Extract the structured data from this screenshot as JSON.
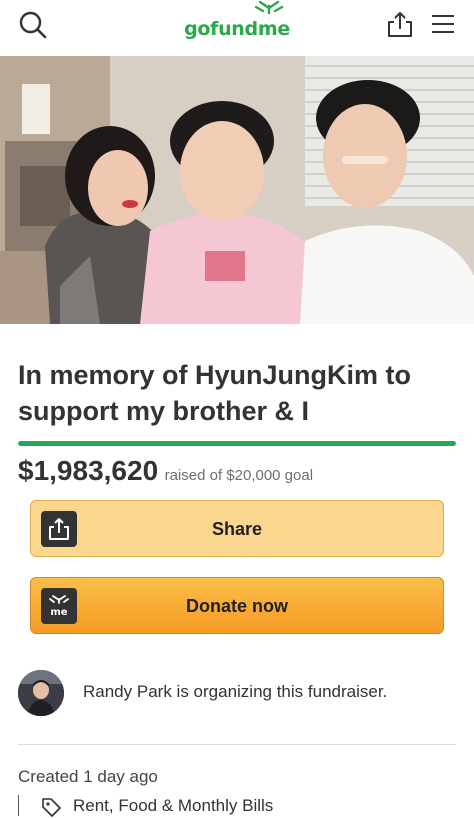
{
  "header": {
    "logo_text": "gofundme",
    "icons": [
      "search-icon",
      "sprout-icon",
      "share-upload-icon",
      "hamburger-menu-icon"
    ]
  },
  "campaign": {
    "title": "In memory of HyunJungKim to support my brother & I",
    "raised_amount": "$1,983,620",
    "goal_text": "raised of $20,000 goal",
    "progress_fraction": 1.0
  },
  "actions": {
    "share_label": "Share",
    "donate_label": "Donate now",
    "donate_icon_text": "me"
  },
  "organizer": {
    "text": "Randy Park is organizing this fundraiser."
  },
  "meta": {
    "created": "Created 1 day ago",
    "category": "Rent, Food & Monthly Bills"
  },
  "colors": {
    "brand_green": "#2aa84a",
    "progress_green": "#26a65b",
    "share_button": "#fbd68e",
    "donate_button": "#f7a931"
  }
}
